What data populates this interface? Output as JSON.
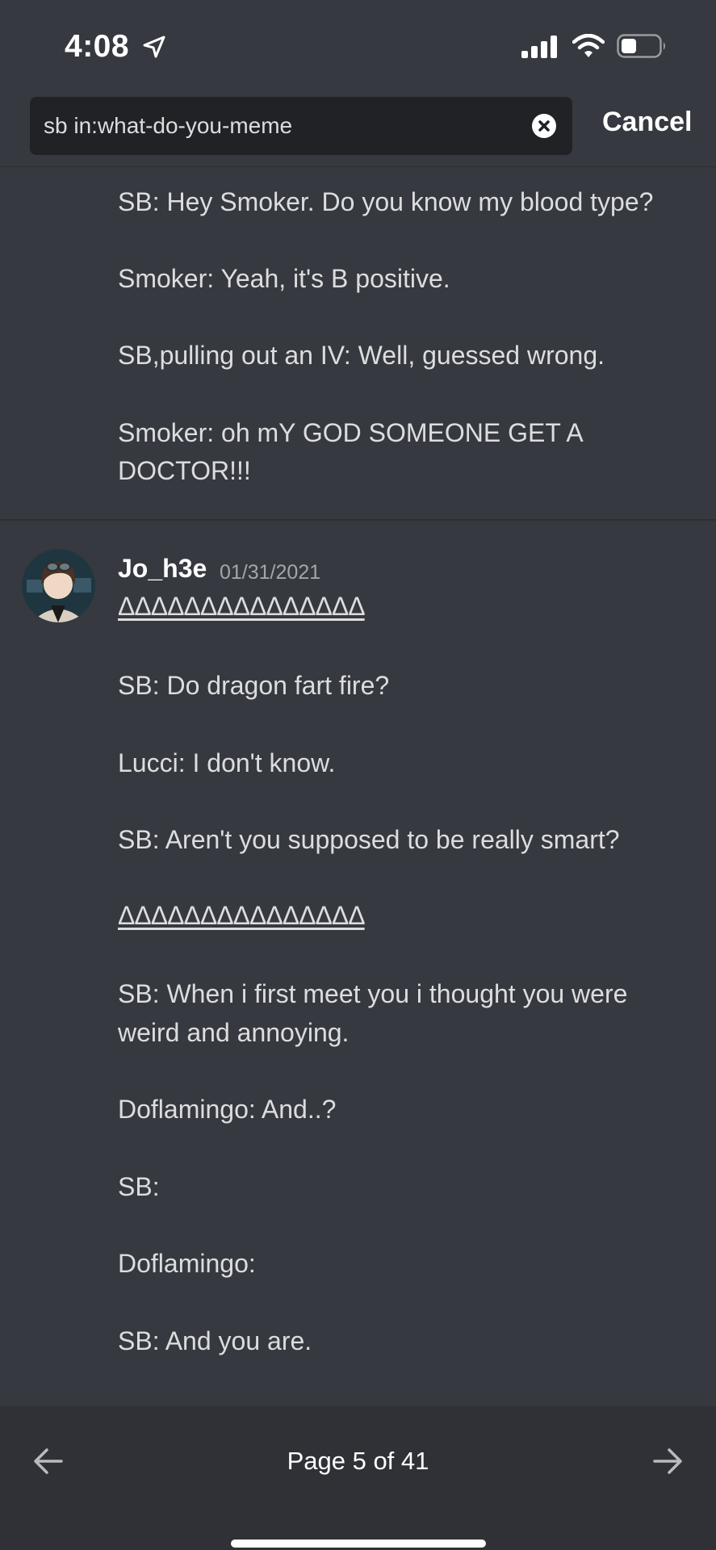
{
  "status_bar": {
    "time": "4:08",
    "icons": [
      "location-arrow-icon",
      "cellular-signal-icon",
      "wifi-icon",
      "battery-icon"
    ]
  },
  "search": {
    "query": "sb in:what-do-you-meme",
    "cancel_label": "Cancel"
  },
  "previous_message": {
    "lines": [
      "SB: Hey Smoker. Do you know my blood type?",
      "Smoker: Yeah, it's B positive.",
      "SB,pulling out an IV: Well, guessed wrong.",
      "Smoker: oh mY GOD SOMEONE GET A",
      "DOCTOR!!!"
    ]
  },
  "message": {
    "author": "Jo_h3e",
    "timestamp": "01/31/2021",
    "separator": "ΔΔΔΔΔΔΔΔΔΔΔΔΔΔΔ",
    "lines": [
      "SB: Do dragon fart fire?",
      "Lucci: I don't know.",
      "SB: Aren't you supposed to be really smart?",
      "SB: When i first meet you i thought you were",
      "weird and annoying.",
      "Doflamingo: And..?",
      "SB:",
      "Doflamingo:",
      "SB: And you are."
    ]
  },
  "pagination": {
    "label": "Page 5 of 41"
  },
  "colors": {
    "background": "#36393f",
    "search_box": "#202225",
    "bottom_bar": "#2f3136",
    "text": "#dcddde",
    "timestamp": "#a3a6aa"
  }
}
